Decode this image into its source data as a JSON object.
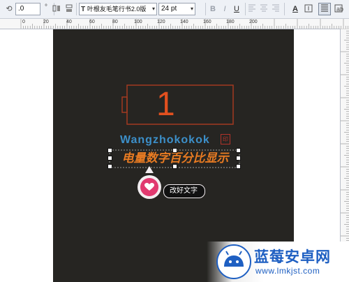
{
  "toolbar": {
    "rotation_value": ".0",
    "rotation_unit": "°",
    "font_icon": "T",
    "font_name": "叶根友毛笔行书2.0版",
    "font_size": "24 pt",
    "bold": "B",
    "italic": "I",
    "underline": "U",
    "text_props_label": "A"
  },
  "ruler": {
    "h_marks": [
      "0",
      "20",
      "40",
      "60",
      "80",
      "100",
      "120",
      "140",
      "160",
      "180",
      "200"
    ]
  },
  "canvas": {
    "battery_number": "1",
    "brand_text": "Wangzhokokok",
    "seal_text": "印",
    "calligraphy_text": "电量数字百分比显示",
    "tooltip_text": "改好文字"
  },
  "watermark": {
    "title": "蓝莓安卓网",
    "url": "www.lmkjst.com"
  },
  "colors": {
    "canvas_bg": "#262522",
    "battery_outline": "#a23a21",
    "battery_digit": "#e2501f",
    "brand_blue": "#3c8fc9",
    "calligraphy_orange": "#e87b22",
    "bubble_pink": "#e1396f",
    "watermark_blue": "#1e5fc2"
  }
}
